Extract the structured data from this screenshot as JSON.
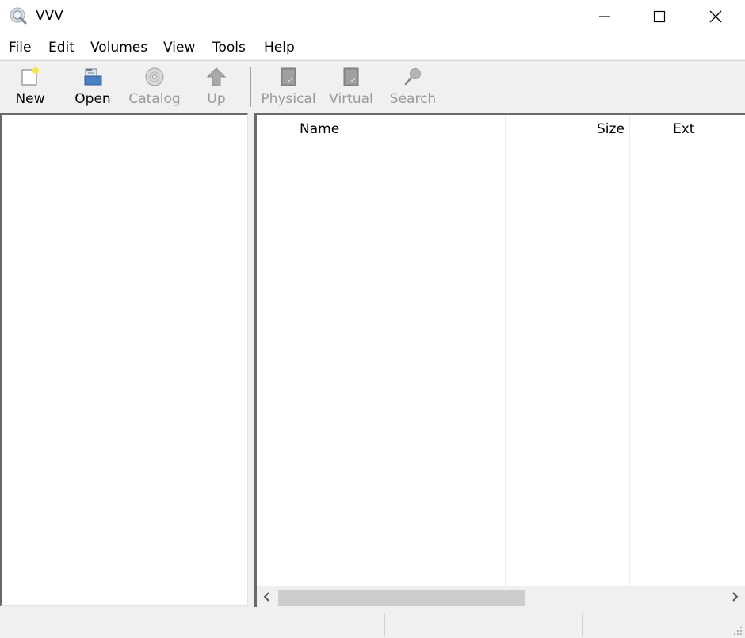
{
  "window": {
    "title": "VVV",
    "app_icon": "magnifier-disc-icon",
    "controls": [
      "minimize-icon",
      "maximize-icon",
      "close-icon"
    ]
  },
  "menu": {
    "items": [
      {
        "label": "File"
      },
      {
        "label": "Edit"
      },
      {
        "label": "Volumes"
      },
      {
        "label": "View"
      },
      {
        "label": "Tools"
      },
      {
        "label": "Help"
      }
    ]
  },
  "toolbar": {
    "buttons": [
      {
        "label": "New",
        "icon": "new-document-icon",
        "enabled": true
      },
      {
        "label": "Open",
        "icon": "open-folder-icon",
        "enabled": true
      },
      {
        "label": "Catalog",
        "icon": "disc-icon",
        "enabled": false
      },
      {
        "label": "Up",
        "icon": "up-arrow-icon",
        "enabled": false
      },
      {
        "label": "Physical",
        "icon": "physical-view-icon",
        "enabled": false
      },
      {
        "label": "Virtual",
        "icon": "virtual-view-icon",
        "enabled": false
      },
      {
        "label": "Search",
        "icon": "search-icon",
        "enabled": false
      }
    ]
  },
  "file_list": {
    "columns": [
      {
        "label": "Name"
      },
      {
        "label": "Size"
      },
      {
        "label": "Ext"
      }
    ],
    "rows": []
  },
  "tree": {
    "items": []
  },
  "scrollbar": {
    "horizontal_position": 0.0,
    "visible_fraction": 0.5
  },
  "statusbar": {
    "panes": [
      "",
      "",
      ""
    ]
  }
}
